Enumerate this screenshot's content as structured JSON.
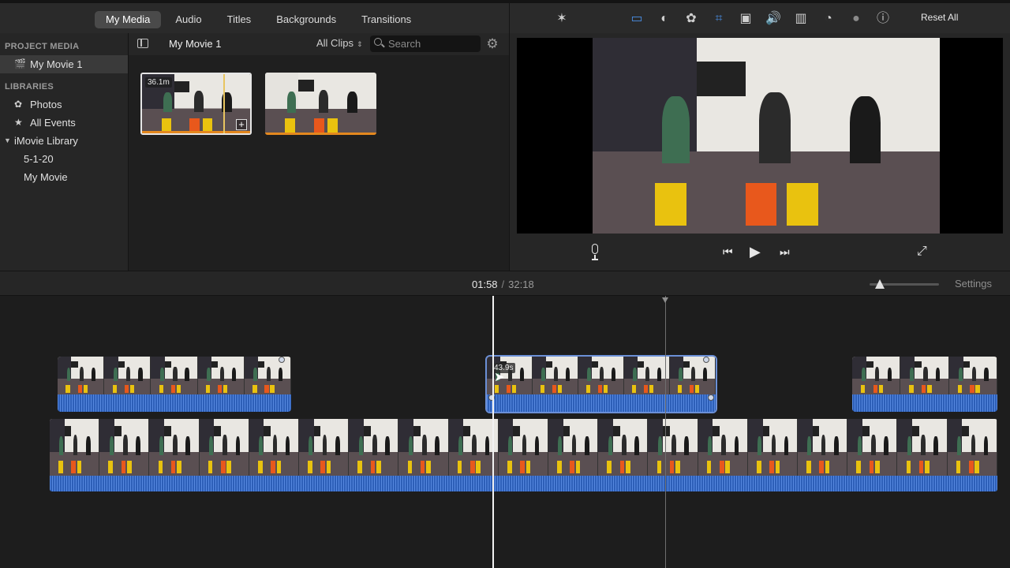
{
  "tabs": [
    "My Media",
    "Audio",
    "Titles",
    "Backgrounds",
    "Transitions"
  ],
  "sidebar": {
    "project_header": "PROJECT MEDIA",
    "project_item": "My Movie 1",
    "libraries_header": "LIBRARIES",
    "library_items": [
      "Photos",
      "All Events"
    ],
    "imovie_library": "iMovie Library",
    "events": [
      "5-1-20",
      "My Movie"
    ]
  },
  "browser": {
    "title": "My Movie 1",
    "filter": "All Clips",
    "search_placeholder": "Search",
    "clips": [
      {
        "duration": "36.1m"
      },
      {
        "duration": ""
      }
    ]
  },
  "viewer": {
    "reset_label": "Reset All",
    "icons": [
      "magic-wand",
      "color-balance",
      "color-correction",
      "color-palette",
      "crop",
      "stabilization",
      "volume",
      "noise-reduction",
      "speed",
      "clip-filter",
      "info"
    ]
  },
  "timeline": {
    "current_time": "01:58",
    "total_time": "32:18",
    "settings_label": "Settings",
    "zoom_level": 0.15,
    "clips": [
      {
        "duration": ""
      },
      {
        "duration": "43.9s"
      },
      {
        "duration": ""
      }
    ]
  },
  "colors": {
    "accent_blue": "#4a8fe6",
    "audio_wave": "#2d5fb8",
    "selection_orange": "#e3881f"
  }
}
